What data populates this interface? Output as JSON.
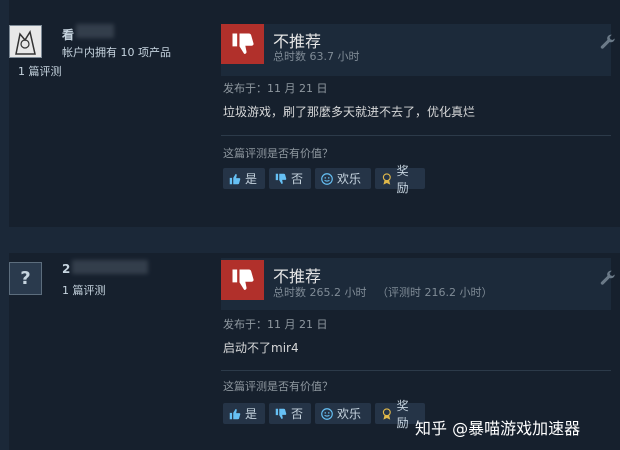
{
  "reviews": [
    {
      "user_name": "看",
      "owned_products": "帐户内拥有 10 项产品",
      "review_count": "1 篇评测",
      "recommendation": "不推荐",
      "hours": "总时数 63.7 小时",
      "posted": "发布于：11 月 21 日",
      "text": "垃圾游戏，刷了那麼多天就进不去了，优化真烂",
      "helpful_prompt": "这篇评测是否有价值？",
      "btn_yes": "是",
      "btn_no": "否",
      "btn_funny": "欢乐",
      "btn_award": "奖励"
    },
    {
      "user_name": "2",
      "review_count": "1 篇评测",
      "recommendation": "不推荐",
      "hours": "总时数 265.2 小时   （评测时 216.2 小时）",
      "posted": "发布于：11 月 21 日",
      "text": "启动不了mir4",
      "helpful_prompt": "这篇评测是否有价值？",
      "btn_yes": "是",
      "btn_no": "否",
      "btn_funny": "欢乐",
      "btn_award": "奖励"
    }
  ],
  "watermark": "知乎 @暴喵游戏加速器",
  "colors": {
    "background": "#1b2838",
    "card": "#16202d",
    "thumb_down": "#b1302b",
    "button": "#253447",
    "accent": "#66c0f4"
  },
  "icons": {
    "thumb": "thumbs-down-icon",
    "wrench": "wrench-icon",
    "yes": "thumbs-up-icon",
    "no": "thumbs-down-icon",
    "funny": "smiley-icon",
    "award": "award-icon"
  }
}
